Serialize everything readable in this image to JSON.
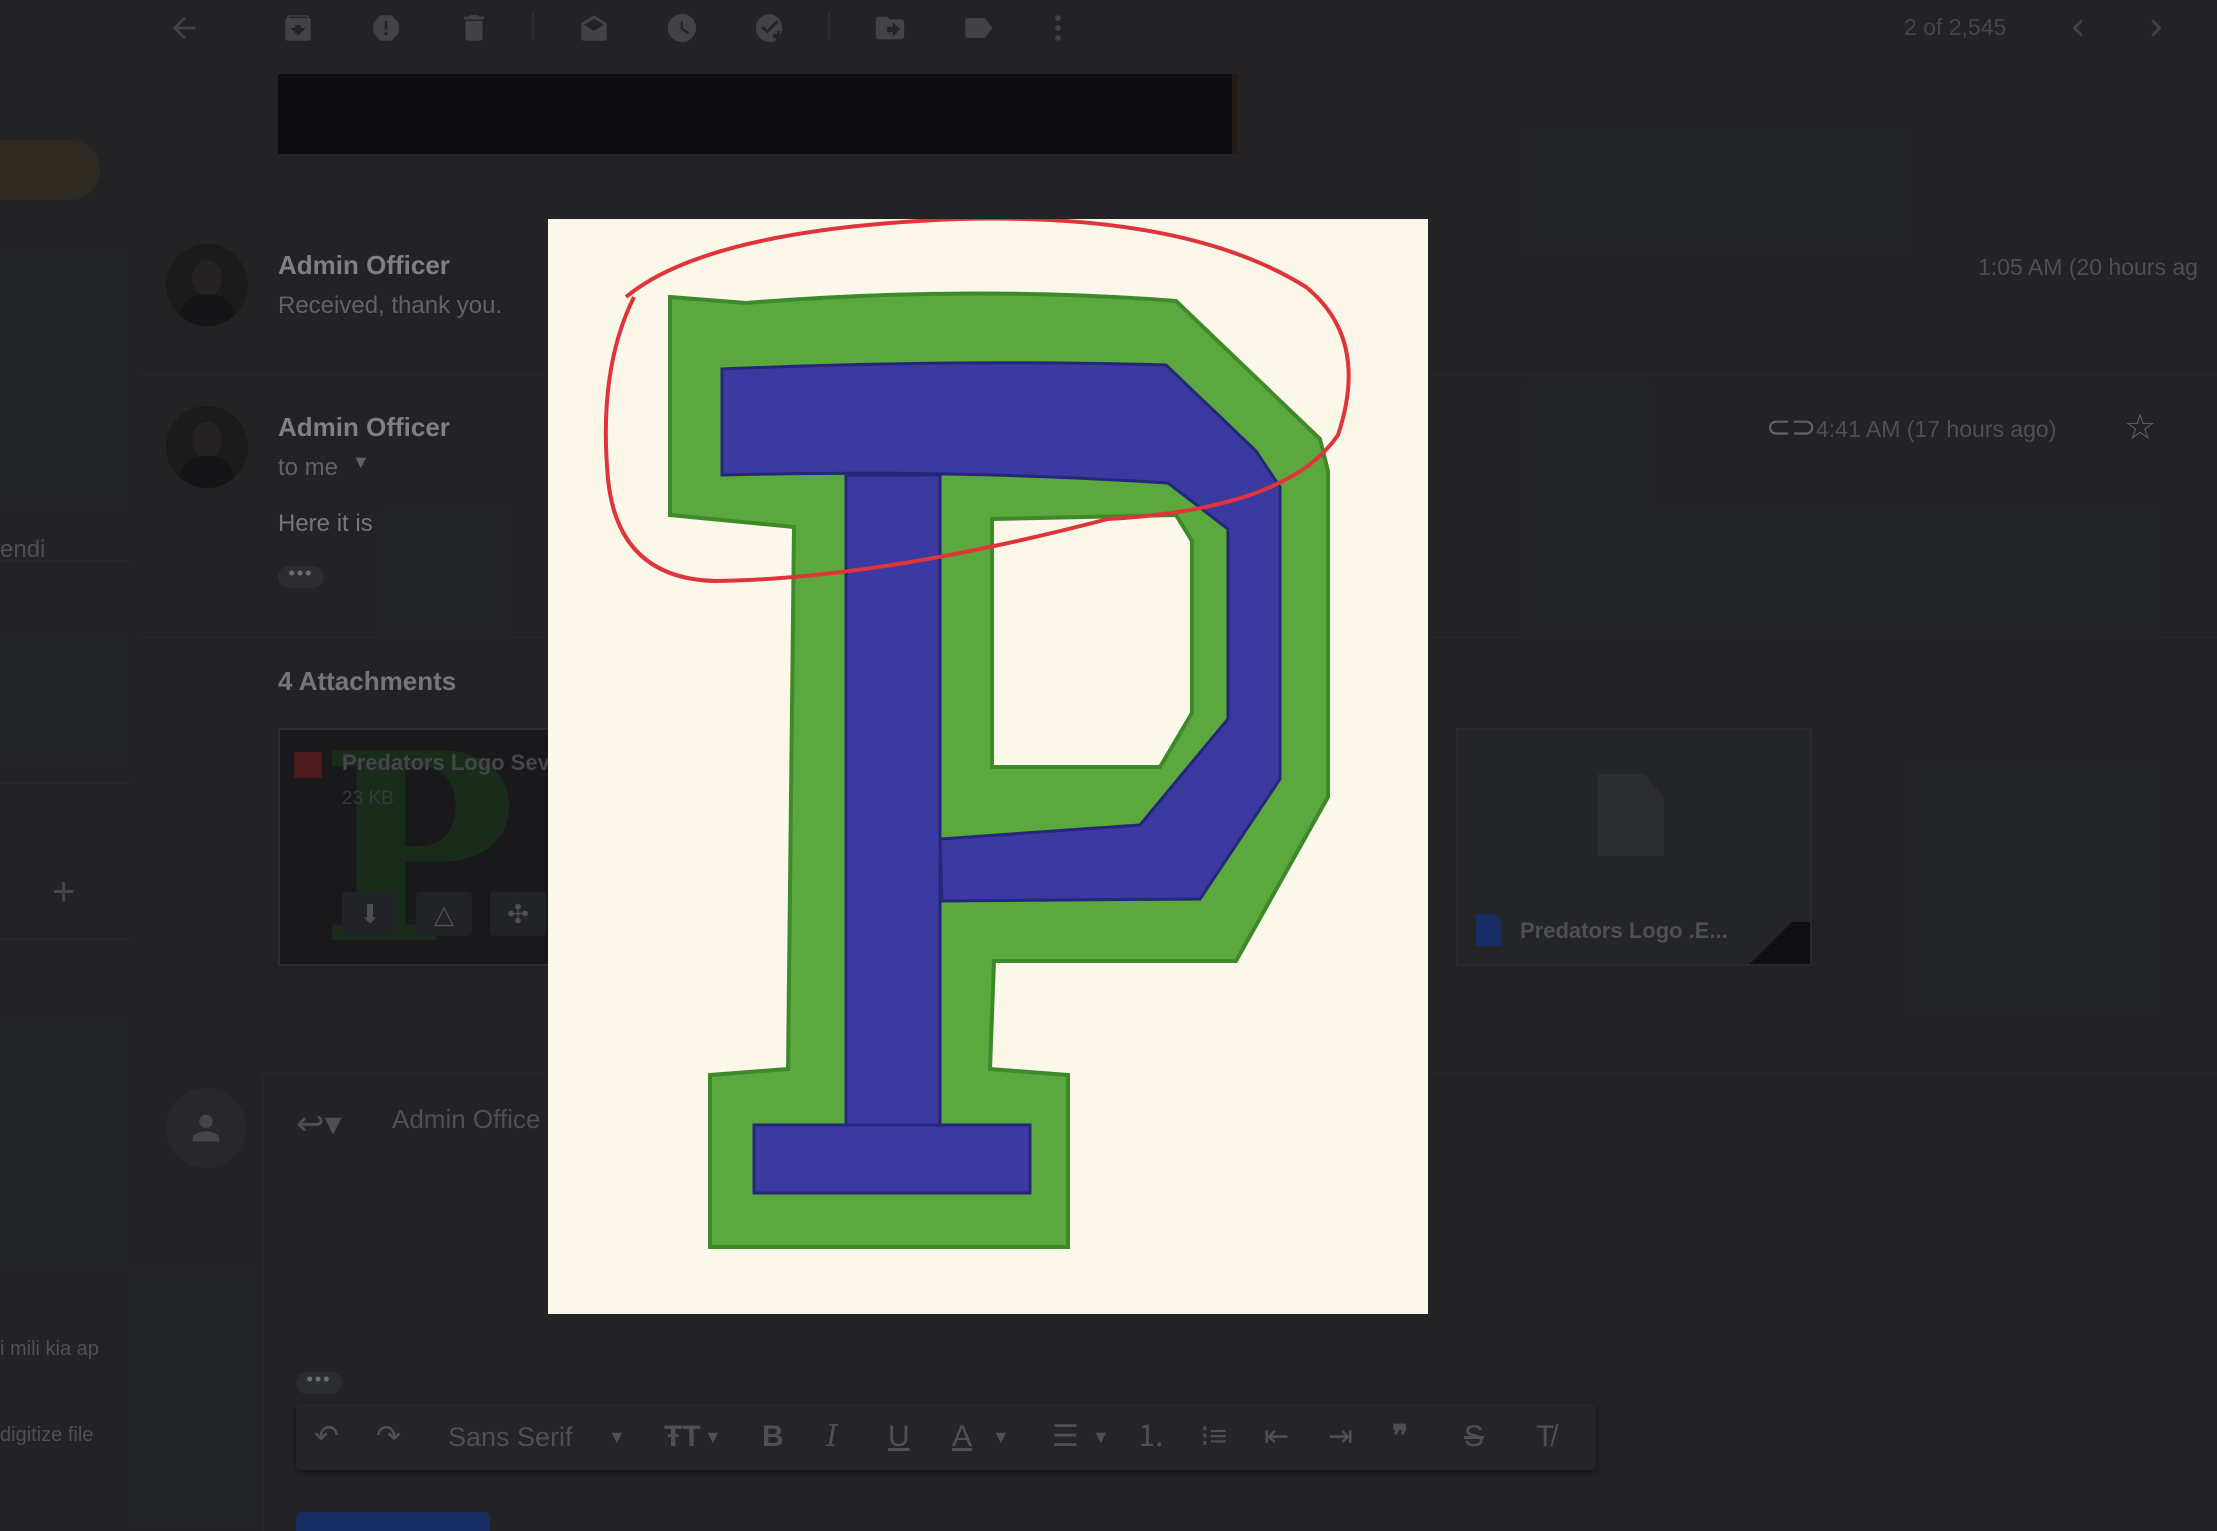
{
  "toolbar": {
    "counter": "2 of 2,545",
    "icons": [
      "back-arrow-icon",
      "archive-icon",
      "report-spam-icon",
      "delete-icon",
      "mark-unread-icon",
      "snooze-icon",
      "add-task-icon",
      "move-to-icon",
      "label-icon",
      "more-vert-icon",
      "newer-chevron-icon",
      "older-chevron-icon"
    ]
  },
  "nav": {
    "partial_label_1": "endi",
    "partial_label_2": "i mili kia ap",
    "partial_label_3": "digitize file",
    "plus": "+"
  },
  "messages": [
    {
      "sender": "Admin Officer",
      "snippet": "Received, thank you.",
      "time": "1:05 AM (20 hours ag"
    },
    {
      "sender": "Admin Officer",
      "recipient": "to me",
      "body": "Here it is",
      "time": "4:41 AM (17 hours ago)",
      "dots": "•••"
    }
  ],
  "attachments": {
    "title": "4 Attachments",
    "items": [
      {
        "name": "Predators Logo Sev",
        "size": "23 KB"
      },
      {
        "name": "Predators Logo .E..."
      }
    ]
  },
  "reply": {
    "to": "Admin Office",
    "dots": "•••",
    "format": {
      "font": "Sans Serif"
    }
  },
  "colors": {
    "background": "#2b2c2f",
    "image_bg": "#fbf8ea",
    "green": "#5aa83e",
    "blue": "#3a3aa0",
    "annotation": "#e0343a"
  }
}
